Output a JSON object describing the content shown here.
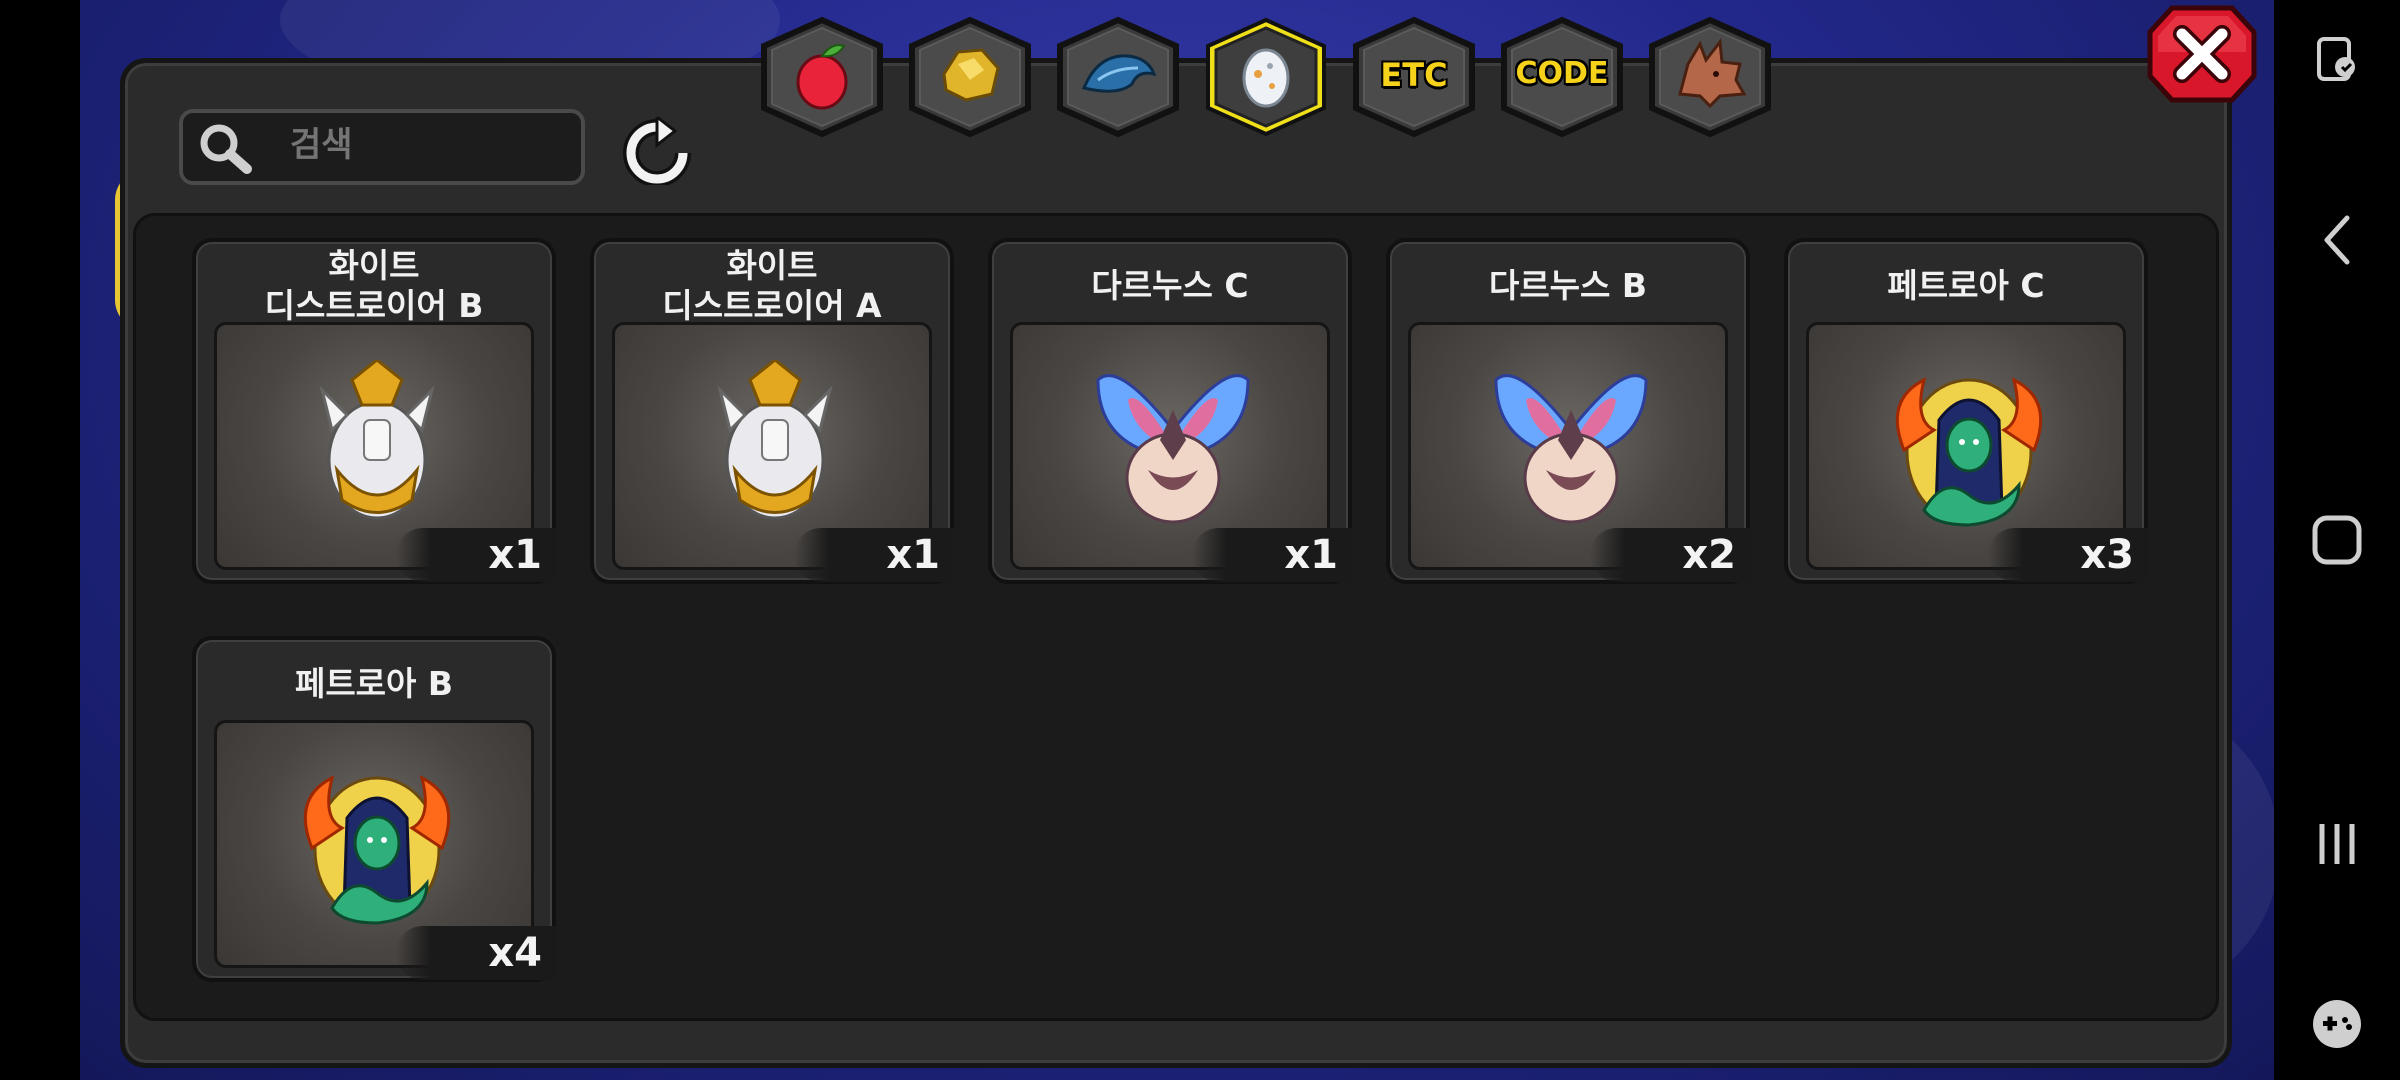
{
  "search": {
    "placeholder": "검색"
  },
  "tabs": [
    {
      "name": "tab-fruit",
      "icon": "red-fruit-icon",
      "label": ""
    },
    {
      "name": "tab-ore",
      "icon": "gold-ore-icon",
      "label": ""
    },
    {
      "name": "tab-scale",
      "icon": "blue-scale-icon",
      "label": ""
    },
    {
      "name": "tab-egg",
      "icon": "egg-icon",
      "label": "",
      "selected": true
    },
    {
      "name": "tab-etc",
      "icon": "",
      "label": "ETC"
    },
    {
      "name": "tab-code",
      "icon": "",
      "label": "CODE"
    },
    {
      "name": "tab-dragon",
      "icon": "dragon-head-icon",
      "label": ""
    }
  ],
  "items": [
    {
      "title": "화이트\n디스트로이어 B",
      "qty": "x1",
      "icon": "white-destroyer-egg-icon"
    },
    {
      "title": "화이트\n디스트로이어 A",
      "qty": "x1",
      "icon": "white-destroyer-egg-icon"
    },
    {
      "title": "다르누스 C",
      "qty": "x1",
      "icon": "darnus-egg-icon"
    },
    {
      "title": "다르누스 B",
      "qty": "x2",
      "icon": "darnus-egg-icon"
    },
    {
      "title": "페트로아 C",
      "qty": "x3",
      "icon": "petroa-egg-icon"
    },
    {
      "title": "페트로아 B",
      "qty": "x4",
      "icon": "petroa-egg-icon"
    }
  ],
  "colors": {
    "panel": "#2b2b2b",
    "tab_selected_border": "#f0e01a",
    "tab_label": "#f7d21a",
    "close_button": "#d8182a"
  },
  "system_nav": [
    "screen-record-icon",
    "back-icon",
    "home-icon",
    "recents-icon",
    "game-controller-icon"
  ]
}
